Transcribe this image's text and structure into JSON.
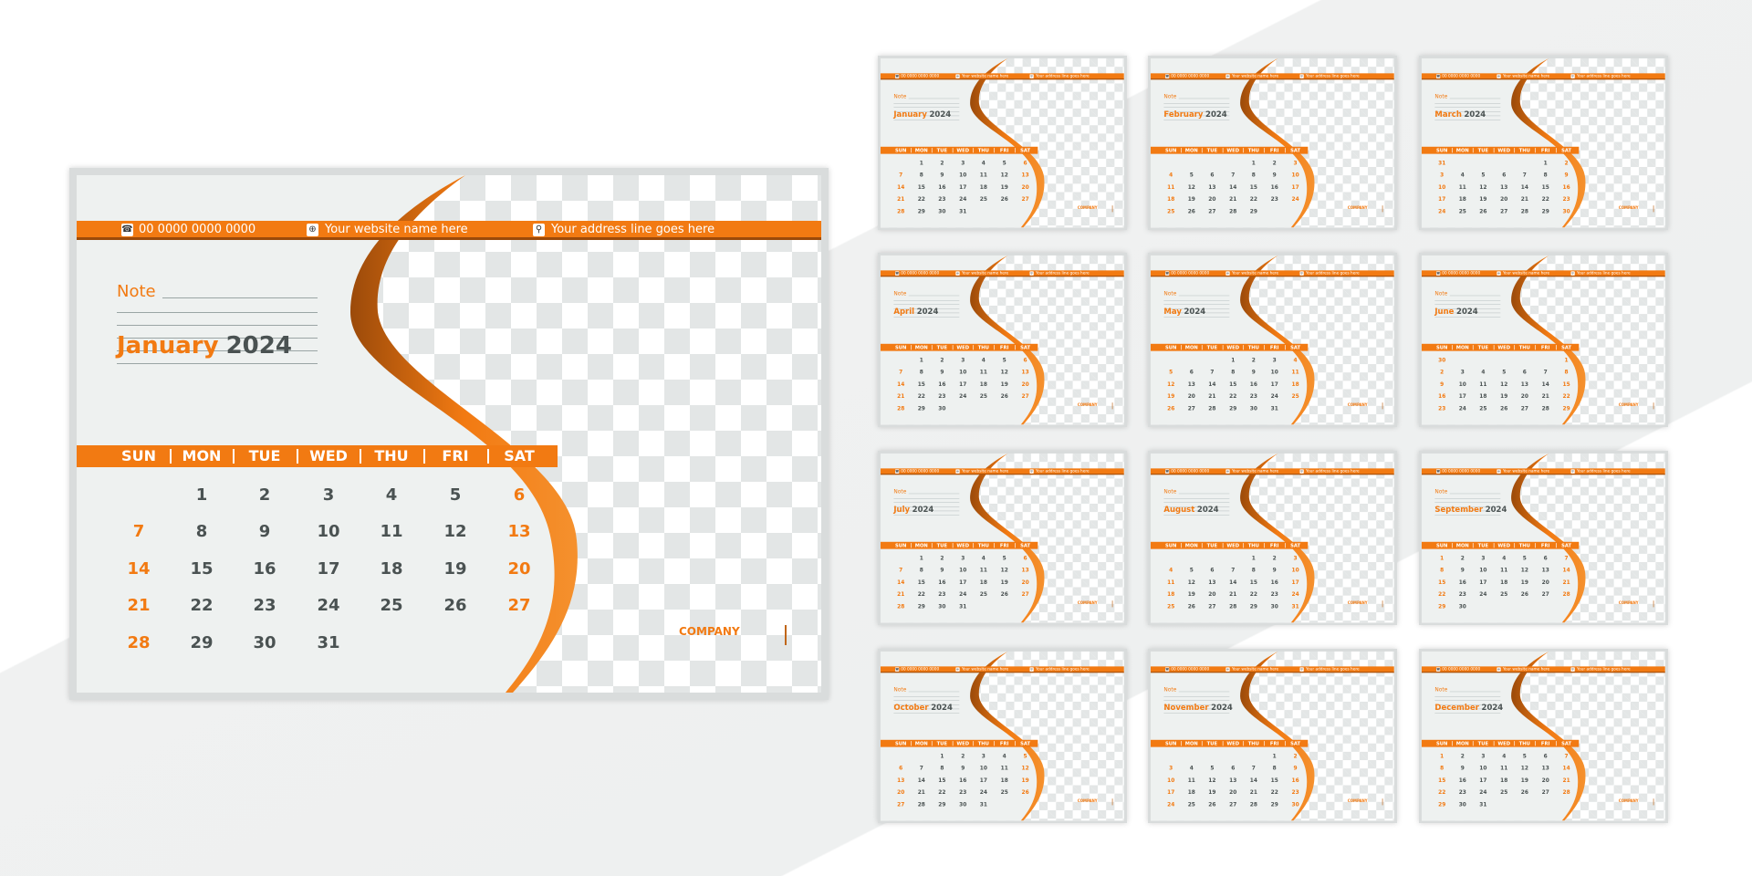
{
  "contact": {
    "phone": "00 0000 0000 0000",
    "website": "Your website name here",
    "address": "Your address line goes here",
    "phone_icon": "phone-icon",
    "website_icon": "globe-icon",
    "address_icon": "map-pin-icon"
  },
  "note_label": "Note",
  "company": "COMPANY",
  "weekdays": [
    "SUN",
    "MON",
    "TUE",
    "WED",
    "THU",
    "FRI",
    "SAT"
  ],
  "colors": {
    "accent": "#f27a12",
    "text": "#4a5252",
    "panel": "#eef1f0"
  },
  "calendars": [
    {
      "month": "January",
      "year": "2024",
      "weeks": [
        [
          "",
          "1",
          "2",
          "3",
          "4",
          "5",
          "6"
        ],
        [
          "7",
          "8",
          "9",
          "10",
          "11",
          "12",
          "13"
        ],
        [
          "14",
          "15",
          "16",
          "17",
          "18",
          "19",
          "20"
        ],
        [
          "21",
          "22",
          "23",
          "24",
          "25",
          "26",
          "27"
        ],
        [
          "28",
          "29",
          "30",
          "31",
          "",
          "",
          ""
        ]
      ]
    },
    {
      "month": "January",
      "year": "2024",
      "weeks": [
        [
          "",
          "1",
          "2",
          "3",
          "4",
          "5",
          "6"
        ],
        [
          "7",
          "8",
          "9",
          "10",
          "11",
          "12",
          "13"
        ],
        [
          "14",
          "15",
          "16",
          "17",
          "18",
          "19",
          "20"
        ],
        [
          "21",
          "22",
          "23",
          "24",
          "25",
          "26",
          "27"
        ],
        [
          "28",
          "29",
          "30",
          "31",
          "",
          "",
          ""
        ]
      ]
    },
    {
      "month": "February",
      "year": "2024",
      "weeks": [
        [
          "",
          "",
          "",
          "",
          "1",
          "2",
          "3"
        ],
        [
          "4",
          "5",
          "6",
          "7",
          "8",
          "9",
          "10"
        ],
        [
          "11",
          "12",
          "13",
          "14",
          "15",
          "16",
          "17"
        ],
        [
          "18",
          "19",
          "20",
          "21",
          "22",
          "23",
          "24"
        ],
        [
          "25",
          "26",
          "27",
          "28",
          "29",
          "",
          ""
        ]
      ]
    },
    {
      "month": "March",
      "year": "2024",
      "weeks": [
        [
          "31",
          "",
          "",
          "",
          "",
          "1",
          "2"
        ],
        [
          "3",
          "4",
          "5",
          "6",
          "7",
          "8",
          "9"
        ],
        [
          "10",
          "11",
          "12",
          "13",
          "14",
          "15",
          "16"
        ],
        [
          "17",
          "18",
          "19",
          "20",
          "21",
          "22",
          "23"
        ],
        [
          "24",
          "25",
          "26",
          "27",
          "28",
          "29",
          "30"
        ]
      ]
    },
    {
      "month": "April",
      "year": "2024",
      "weeks": [
        [
          "",
          "1",
          "2",
          "3",
          "4",
          "5",
          "6"
        ],
        [
          "7",
          "8",
          "9",
          "10",
          "11",
          "12",
          "13"
        ],
        [
          "14",
          "15",
          "16",
          "17",
          "18",
          "19",
          "20"
        ],
        [
          "21",
          "22",
          "23",
          "24",
          "25",
          "26",
          "27"
        ],
        [
          "28",
          "29",
          "30",
          "",
          "",
          "",
          ""
        ]
      ]
    },
    {
      "month": "May",
      "year": "2024",
      "weeks": [
        [
          "",
          "",
          "",
          "1",
          "2",
          "3",
          "4"
        ],
        [
          "5",
          "6",
          "7",
          "8",
          "9",
          "10",
          "11"
        ],
        [
          "12",
          "13",
          "14",
          "15",
          "16",
          "17",
          "18"
        ],
        [
          "19",
          "20",
          "21",
          "22",
          "23",
          "24",
          "25"
        ],
        [
          "26",
          "27",
          "28",
          "29",
          "30",
          "31",
          ""
        ]
      ]
    },
    {
      "month": "June",
      "year": "2024",
      "weeks": [
        [
          "30",
          "",
          "",
          "",
          "",
          "",
          "1"
        ],
        [
          "2",
          "3",
          "4",
          "5",
          "6",
          "7",
          "8"
        ],
        [
          "9",
          "10",
          "11",
          "12",
          "13",
          "14",
          "15"
        ],
        [
          "16",
          "17",
          "18",
          "19",
          "20",
          "21",
          "22"
        ],
        [
          "23",
          "24",
          "25",
          "26",
          "27",
          "28",
          "29"
        ]
      ]
    },
    {
      "month": "July",
      "year": "2024",
      "weeks": [
        [
          "",
          "1",
          "2",
          "3",
          "4",
          "5",
          "6"
        ],
        [
          "7",
          "8",
          "9",
          "10",
          "11",
          "12",
          "13"
        ],
        [
          "14",
          "15",
          "16",
          "17",
          "18",
          "19",
          "20"
        ],
        [
          "21",
          "22",
          "23",
          "24",
          "25",
          "26",
          "27"
        ],
        [
          "28",
          "29",
          "30",
          "31",
          "",
          "",
          ""
        ]
      ]
    },
    {
      "month": "August",
      "year": "2024",
      "weeks": [
        [
          "",
          "",
          "",
          "",
          "1",
          "2",
          "3"
        ],
        [
          "4",
          "5",
          "6",
          "7",
          "8",
          "9",
          "10"
        ],
        [
          "11",
          "12",
          "13",
          "14",
          "15",
          "16",
          "17"
        ],
        [
          "18",
          "19",
          "20",
          "21",
          "22",
          "23",
          "24"
        ],
        [
          "25",
          "26",
          "27",
          "28",
          "29",
          "30",
          "31"
        ]
      ]
    },
    {
      "month": "September",
      "year": "2024",
      "weeks": [
        [
          "1",
          "2",
          "3",
          "4",
          "5",
          "6",
          "7"
        ],
        [
          "8",
          "9",
          "10",
          "11",
          "12",
          "13",
          "14"
        ],
        [
          "15",
          "16",
          "17",
          "18",
          "19",
          "20",
          "21"
        ],
        [
          "22",
          "23",
          "24",
          "25",
          "26",
          "27",
          "28"
        ],
        [
          "29",
          "30",
          "",
          "",
          "",
          "",
          ""
        ]
      ]
    },
    {
      "month": "October",
      "year": "2024",
      "weeks": [
        [
          "",
          "",
          "1",
          "2",
          "3",
          "4",
          "5"
        ],
        [
          "6",
          "7",
          "8",
          "9",
          "10",
          "11",
          "12"
        ],
        [
          "13",
          "14",
          "15",
          "16",
          "17",
          "18",
          "19"
        ],
        [
          "20",
          "21",
          "22",
          "23",
          "24",
          "25",
          "26"
        ],
        [
          "27",
          "28",
          "29",
          "30",
          "31",
          "",
          ""
        ]
      ]
    },
    {
      "month": "November",
      "year": "2024",
      "weeks": [
        [
          "",
          "",
          "",
          "",
          "",
          "1",
          "2"
        ],
        [
          "3",
          "4",
          "5",
          "6",
          "7",
          "8",
          "9"
        ],
        [
          "10",
          "11",
          "12",
          "13",
          "14",
          "15",
          "16"
        ],
        [
          "17",
          "18",
          "19",
          "20",
          "21",
          "22",
          "23"
        ],
        [
          "24",
          "25",
          "26",
          "27",
          "28",
          "29",
          "30"
        ]
      ]
    },
    {
      "month": "December",
      "year": "2024",
      "weeks": [
        [
          "1",
          "2",
          "3",
          "4",
          "5",
          "6",
          "7"
        ],
        [
          "8",
          "9",
          "10",
          "11",
          "12",
          "13",
          "14"
        ],
        [
          "15",
          "16",
          "17",
          "18",
          "19",
          "20",
          "21"
        ],
        [
          "22",
          "23",
          "24",
          "25",
          "26",
          "27",
          "28"
        ],
        [
          "29",
          "30",
          "31",
          "",
          "",
          "",
          ""
        ]
      ]
    }
  ]
}
